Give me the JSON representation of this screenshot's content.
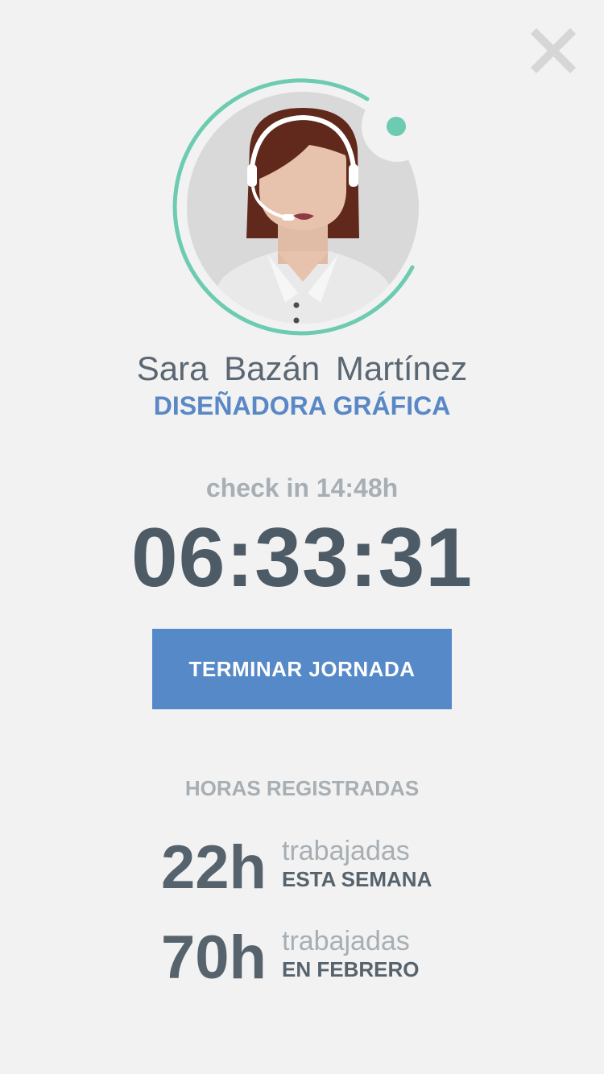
{
  "colors": {
    "background": "#f2f2f2",
    "accent_blue": "#5689c8",
    "status_green": "#6ccbb1",
    "text_dark": "#4d5b66",
    "text_muted": "#a7afb5"
  },
  "header": {
    "close_icon": "close-icon"
  },
  "profile": {
    "avatar_icon": "operator-with-headset-icon",
    "status_dot": "online-status-dot",
    "name": "Sara Bazán Martínez",
    "role": "DISEÑADORA GRÁFICA"
  },
  "session": {
    "check_in": "check in 14:48h",
    "elapsed": "06:33:31",
    "end_button": "TERMINAR JORNADA"
  },
  "hours": {
    "title": "HORAS REGISTRADAS",
    "items": [
      {
        "value": "22h",
        "label": "trabajadas",
        "period": "ESTA SEMANA"
      },
      {
        "value": "70h",
        "label": "trabajadas",
        "period": "EN FEBRERO"
      }
    ]
  }
}
